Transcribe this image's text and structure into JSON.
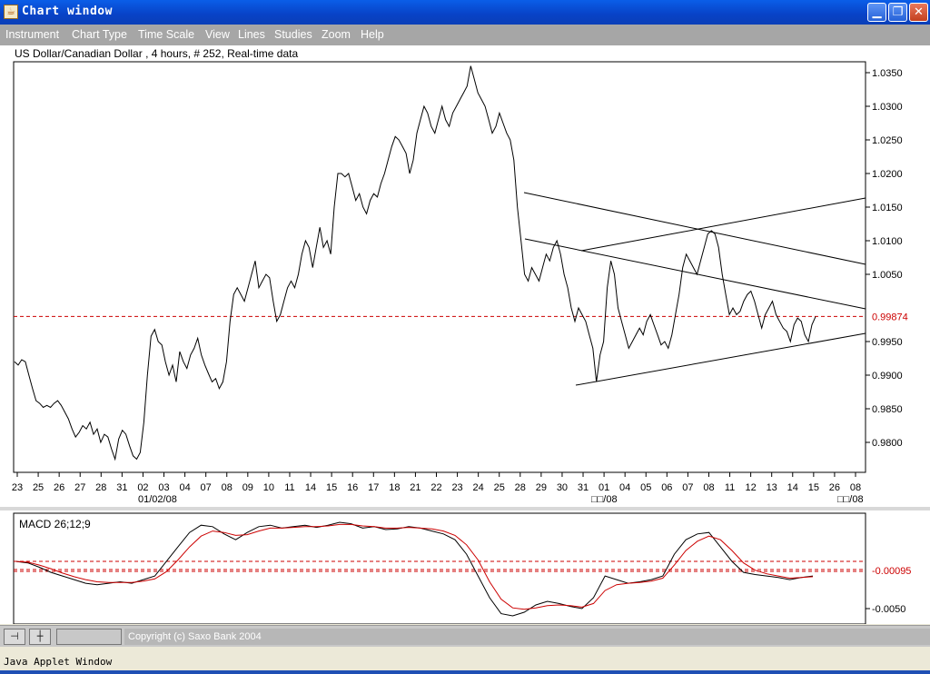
{
  "window": {
    "title": "Chart window",
    "icon": "java-cup-icon",
    "buttons": [
      "minimize-icon",
      "maximize-icon",
      "close-icon"
    ]
  },
  "menu": [
    "Instrument",
    "Chart Type",
    "Time Scale",
    "View",
    "Lines",
    "Studies",
    "Zoom",
    "Help"
  ],
  "chart": {
    "header": "US Dollar/Canadian Dollar , 4 hours, # 252, Real-time data",
    "current_price_label": "0.99874",
    "current_price": 0.99874,
    "y_ticks": [
      "1.0350",
      "1.0300",
      "1.0250",
      "1.0200",
      "1.0150",
      "1.0100",
      "1.0050",
      "0.9950",
      "0.9900",
      "0.9850",
      "0.9800"
    ],
    "x_ticks": [
      "23",
      "25",
      "26",
      "27",
      "28",
      "31",
      "02",
      "03",
      "04",
      "07",
      "08",
      "09",
      "10",
      "11",
      "14",
      "15",
      "16",
      "17",
      "18",
      "21",
      "22",
      "23",
      "24",
      "25",
      "28",
      "29",
      "30",
      "31",
      "01",
      "04",
      "05",
      "06",
      "07",
      "08",
      "11",
      "12",
      "13",
      "14",
      "15",
      "26",
      "08"
    ],
    "x_sub_labels": [
      "01/02/08",
      "□□/08",
      "□□/08"
    ]
  },
  "chart_data": [
    {
      "type": "line",
      "title": "US Dollar/Canadian Dollar , 4 hours, # 252, Real-time data",
      "ylim": [
        0.976,
        1.037
      ],
      "reference_line": 0.99874,
      "series": [
        {
          "values": [
            0.992,
            0.9915,
            0.9923,
            0.992,
            0.99,
            0.988,
            0.9862,
            0.9858,
            0.9852,
            0.9855,
            0.9852,
            0.9858,
            0.9862,
            0.9855,
            0.9845,
            0.9835,
            0.982,
            0.9808,
            0.9815,
            0.9825,
            0.982,
            0.983,
            0.9812,
            0.982,
            0.98,
            0.9812,
            0.9808,
            0.979,
            0.9775,
            0.9805,
            0.9818,
            0.9812,
            0.9795,
            0.978,
            0.9775,
            0.9785,
            0.983,
            0.99,
            0.9958,
            0.9968,
            0.995,
            0.9945,
            0.992,
            0.99,
            0.9915,
            0.989,
            0.9935,
            0.992,
            0.991,
            0.993,
            0.994,
            0.9955,
            0.993,
            0.9915,
            0.9902,
            0.989,
            0.9895,
            0.988,
            0.989,
            0.992,
            0.998,
            1.002,
            1.003,
            1.002,
            1.001,
            1.003,
            1.005,
            1.007,
            1.003,
            1.004,
            1.005,
            1.0045,
            1.001,
            0.998,
            0.999,
            1.001,
            1.003,
            1.004,
            1.003,
            1.005,
            1.008,
            1.01,
            1.009,
            1.006,
            1.009,
            1.012,
            1.009,
            1.01,
            1.008,
            1.015,
            1.02,
            1.02,
            1.0195,
            1.02,
            1.018,
            1.016,
            1.017,
            1.015,
            1.014,
            1.016,
            1.017,
            1.0165,
            1.0185,
            1.02,
            1.022,
            1.024,
            1.0255,
            1.025,
            1.024,
            1.023,
            1.02,
            1.022,
            1.026,
            1.028,
            1.03,
            1.029,
            1.027,
            1.026,
            1.028,
            1.03,
            1.028,
            1.027,
            1.029,
            1.03,
            1.031,
            1.032,
            1.033,
            1.036,
            1.034,
            1.032,
            1.031,
            1.03,
            1.028,
            1.026,
            1.027,
            1.029,
            1.0275,
            1.026,
            1.025,
            1.022,
            1.015,
            1.01,
            1.005,
            1.004,
            1.006,
            1.005,
            1.004,
            1.006,
            1.008,
            1.007,
            1.009,
            1.01,
            1.008,
            1.005,
            1.003,
            1.0,
            0.998,
            1.0,
            0.999,
            0.998,
            0.996,
            0.994,
            0.989,
            0.993,
            0.995,
            1.003,
            1.007,
            1.005,
            1.0,
            0.998,
            0.996,
            0.994,
            0.995,
            0.996,
            0.997,
            0.996,
            0.998,
            0.999,
            0.9975,
            0.996,
            0.9945,
            0.995,
            0.994,
            0.996,
            0.999,
            1.002,
            1.006,
            1.008,
            1.007,
            1.006,
            1.005,
            1.007,
            1.009,
            1.011,
            1.0115,
            1.011,
            1.009,
            1.005,
            1.002,
            0.999,
            1.0,
            0.999,
            0.9995,
            1.001,
            1.002,
            1.0025,
            1.001,
            0.999,
            0.997,
            0.999,
            1.0,
            1.001,
            0.999,
            0.998,
            0.997,
            0.9965,
            0.995,
            0.9975,
            0.9985,
            0.998,
            0.996,
            0.995,
            0.9975,
            0.9987
          ]
        }
      ]
    },
    {
      "type": "line",
      "title": "MACD 26;12;9",
      "reference_value_label": "-0.00095",
      "y_ticks": [
        "-0.00095",
        "-0.0050"
      ],
      "series": [
        {
          "values": [
            0.001,
            0.0008,
            0.0002,
            -0.0005,
            -0.001,
            -0.0015,
            -0.002,
            -0.0022,
            -0.002,
            -0.0018,
            -0.002,
            -0.0015,
            -0.001,
            0.001,
            0.003,
            0.005,
            0.006,
            0.0058,
            0.0048,
            0.004,
            0.005,
            0.0058,
            0.006,
            0.0056,
            0.0058,
            0.006,
            0.0057,
            0.006,
            0.0064,
            0.0062,
            0.0056,
            0.0058,
            0.0054,
            0.0055,
            0.0058,
            0.0056,
            0.0052,
            0.0048,
            0.004,
            0.002,
            -0.001,
            -0.004,
            -0.0062,
            -0.0065,
            -0.006,
            -0.005,
            -0.0045,
            -0.0048,
            -0.0052,
            -0.0055,
            -0.004,
            -0.001,
            -0.0015,
            -0.002,
            -0.0018,
            -0.0015,
            -0.001,
            0.002,
            0.004,
            0.0048,
            0.005,
            0.003,
            0.001,
            -0.0005,
            -0.0008,
            -0.001,
            -0.0012,
            -0.0015,
            -0.0012,
            -0.001
          ]
        },
        {
          "values": [
            0.001,
            0.0009,
            0.0005,
            0.0,
            -0.0006,
            -0.0011,
            -0.0015,
            -0.0018,
            -0.0019,
            -0.0019,
            -0.0019,
            -0.0017,
            -0.0014,
            -0.0004,
            0.0012,
            0.003,
            0.0045,
            0.0052,
            0.005,
            0.0046,
            0.0047,
            0.0052,
            0.0056,
            0.0056,
            0.0057,
            0.0058,
            0.0058,
            0.0059,
            0.0061,
            0.0061,
            0.0059,
            0.0058,
            0.0056,
            0.0056,
            0.0057,
            0.0056,
            0.0055,
            0.0052,
            0.0046,
            0.0033,
            0.0012,
            -0.0018,
            -0.0042,
            -0.0054,
            -0.0056,
            -0.0054,
            -0.0051,
            -0.005,
            -0.0051,
            -0.0053,
            -0.0048,
            -0.003,
            -0.0022,
            -0.002,
            -0.0019,
            -0.0017,
            -0.0013,
            0.0005,
            0.0025,
            0.0038,
            0.0045,
            0.004,
            0.0025,
            0.0008,
            -0.0002,
            -0.0007,
            -0.001,
            -0.0013,
            -0.0012,
            -0.0011
          ]
        }
      ]
    }
  ],
  "bottom": {
    "copyright": "Copyright (c) Saxo Bank 2004",
    "buttons": [
      "pin-icon",
      "crosshair-icon"
    ]
  },
  "status": {
    "text": "Java Applet Window"
  }
}
